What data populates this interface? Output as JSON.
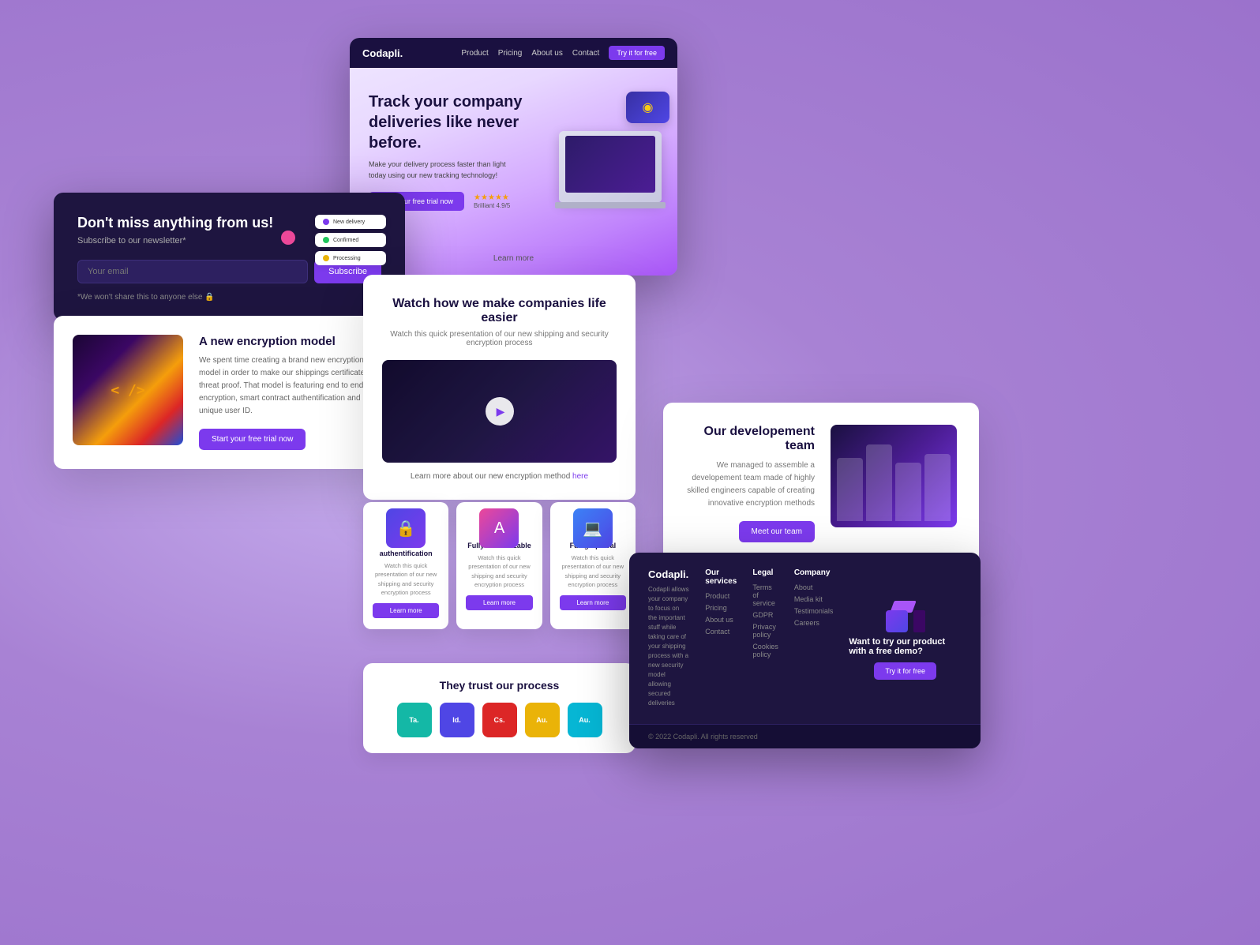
{
  "background": {
    "color": "#b89ee0"
  },
  "hero": {
    "nav": {
      "logo": "Codapli.",
      "links": [
        "Product",
        "Pricing",
        "About us",
        "Contact"
      ],
      "cta_btn": "Try it for free"
    },
    "title": "Track your company deliveries like never before.",
    "subtitle": "Make your delivery process faster than light today using our new tracking technology!",
    "cta_btn": "Start your free trial now",
    "rating_stars": "★★★★★",
    "rating_text": "Brilliant 4.9/5",
    "learn_more": "Learn more"
  },
  "newsletter": {
    "title": "Don't miss anything from us!",
    "subtitle": "Subscribe to our newsletter*",
    "input_placeholder": "Your email",
    "subscribe_btn": "Subscribe",
    "disclaimer": "*We won't share this to anyone else 🔒"
  },
  "encryption": {
    "title": "A new encryption model",
    "text": "We spent time creating a brand new encryption model in order to make our shippings certificates threat proof. That model is featuring end to end encryption, smart contract authentification and unique user ID.",
    "cta_btn": "Start your free trial now"
  },
  "video": {
    "title": "Watch how we make companies life easier",
    "subtitle": "Watch this quick presentation of our new shipping and security encryption process",
    "caption_text": "Learn more about our new encryption method",
    "caption_link": "here"
  },
  "features": [
    {
      "icon": "🔒",
      "title": "Secure authentification",
      "text": "Watch this quick presentation of our new shipping and security encryption process",
      "btn": "Learn more"
    },
    {
      "icon": "A",
      "title": "Fully customizable",
      "text": "Watch this quick presentation of our new shipping and security encryption process",
      "btn": "Learn more"
    },
    {
      "icon": "💻",
      "title": "Full graphical",
      "text": "Watch this quick presentation of our new shipping and security encryption process",
      "btn": "Learn more"
    }
  ],
  "team": {
    "title": "Our developement team",
    "text": "We managed to assemble a developement team made of highly skilled engineers capable of creating innovative encryption methods",
    "btn": "Meet our team"
  },
  "trust": {
    "title": "They trust our process",
    "logos": [
      {
        "label": "Ta.",
        "color": "teal"
      },
      {
        "label": "Id.",
        "color": "blue"
      },
      {
        "label": "Cs.",
        "color": "red"
      },
      {
        "label": "Au.",
        "color": "yellow"
      },
      {
        "label": "Au.",
        "color": "cyan"
      }
    ]
  },
  "footer": {
    "brand": "Codapli.",
    "brand_text": "Codapli allows your company to focus on the important stuff while taking care of your shipping process with a new security model allowing secured deliveries",
    "cols": [
      {
        "title": "Our services",
        "links": [
          "Product",
          "Pricing",
          "About us",
          "Contact"
        ]
      },
      {
        "title": "Legal",
        "links": [
          "Terms of service",
          "GDPR",
          "Privacy policy",
          "Cookies policy"
        ]
      },
      {
        "title": "Company",
        "links": [
          "About",
          "Media kit",
          "Testimonials",
          "Careers"
        ]
      }
    ],
    "cta_text": "Want to try our product with a free demo?",
    "cta_btn": "Try it for free",
    "copyright": "© 2022 Codapli. All rights reserved"
  }
}
